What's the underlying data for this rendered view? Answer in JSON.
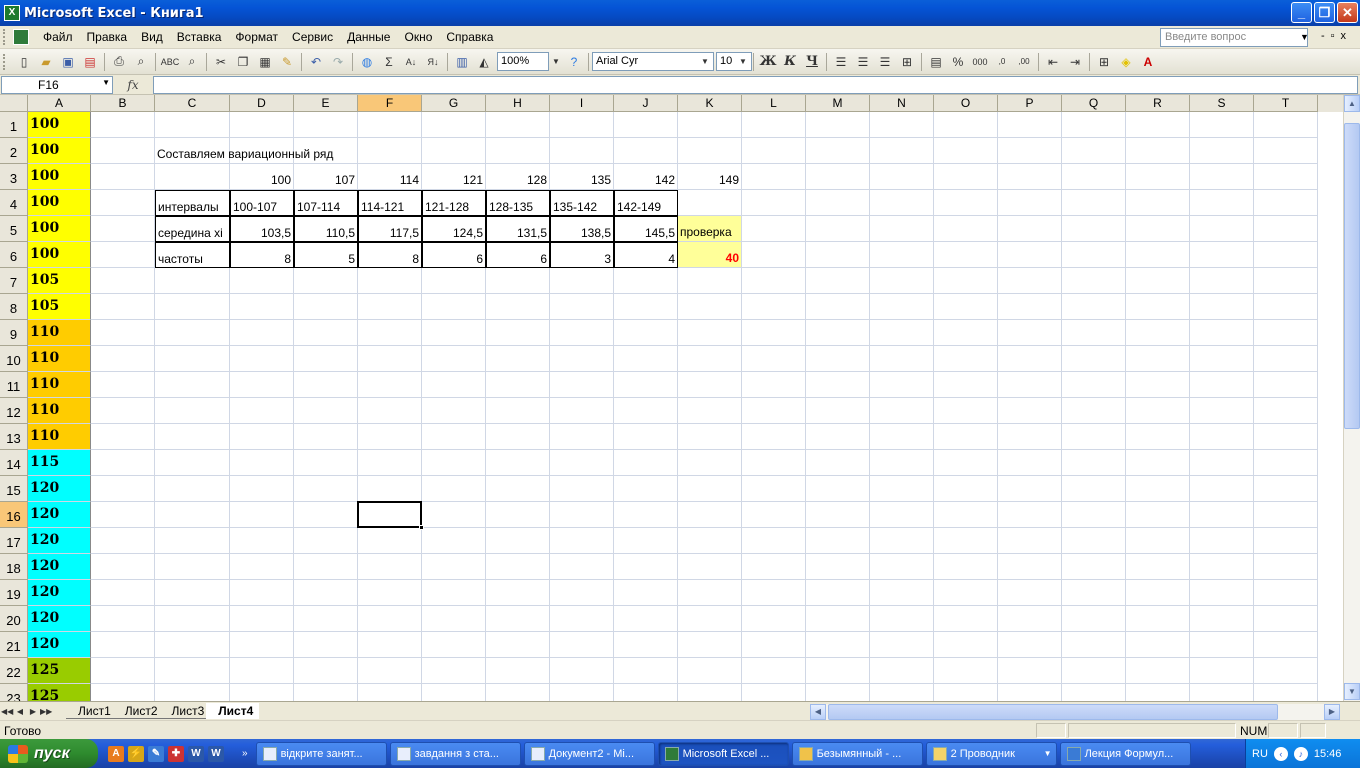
{
  "window": {
    "title": "Microsoft Excel - Книга1",
    "icon": "excel-icon"
  },
  "menu": [
    "Файл",
    "Правка",
    "Вид",
    "Вставка",
    "Формат",
    "Сервис",
    "Данные",
    "Окно",
    "Справка"
  ],
  "ask_placeholder": "Введите вопрос",
  "toolbar": {
    "zoom": "100%",
    "font": "Arial Cyr",
    "font_size": "10",
    "bold": "Ж",
    "italic": "К",
    "underline": "Ч"
  },
  "formula_bar": {
    "name_box": "F16",
    "fx": "fx",
    "formula": ""
  },
  "columns": [
    "A",
    "B",
    "C",
    "D",
    "E",
    "F",
    "G",
    "H",
    "I",
    "J",
    "K",
    "L",
    "M",
    "N",
    "O",
    "P",
    "Q",
    "R",
    "S",
    "T"
  ],
  "selected_column": "F",
  "selected_row": "16",
  "rows": [
    "1",
    "2",
    "3",
    "4",
    "5",
    "6",
    "7",
    "8",
    "9",
    "10",
    "11",
    "12",
    "13",
    "14",
    "15",
    "16",
    "17",
    "18",
    "19",
    "20",
    "21",
    "22",
    "23"
  ],
  "col_a_values": [
    "100",
    "100",
    "100",
    "100",
    "100",
    "100",
    "105",
    "105",
    "110",
    "110",
    "110",
    "110",
    "110",
    "115",
    "120",
    "120",
    "120",
    "120",
    "120",
    "120",
    "120",
    "125",
    "125"
  ],
  "colors": {
    "yellow": "#ffff00",
    "orange": "#ffcc00",
    "cyan": "#00ffff",
    "green": "#99cc00",
    "check_bg": "#ffff99",
    "check_text": "#ff0000",
    "selection": "#f9c778"
  },
  "table": {
    "title": "Составляем вариационный ряд",
    "bounds": [
      "100",
      "107",
      "114",
      "121",
      "128",
      "135",
      "142",
      "149"
    ],
    "intervals_label": "интервалы",
    "intervals": [
      "100-107",
      "107-114",
      "114-121",
      "121-128",
      "128-135",
      "135-142",
      "142-149"
    ],
    "mid_label": "середина xi",
    "mids": [
      "103,5",
      "110,5",
      "117,5",
      "124,5",
      "131,5",
      "138,5",
      "145,5"
    ],
    "freq_label": "частоты",
    "freqs": [
      "8",
      "5",
      "8",
      "6",
      "6",
      "3",
      "4"
    ],
    "check_label": "проверка",
    "check_value": "40"
  },
  "sheets": [
    "Лист1",
    "Лист2",
    "Лист3",
    "Лист4"
  ],
  "active_sheet": "Лист4",
  "status": {
    "ready": "Готово",
    "num": "NUM"
  },
  "taskbar": {
    "start": "пуск",
    "tasks": [
      "відкрите занят...",
      "завдання з ста...",
      "Документ2 - Mi...",
      "Microsoft Excel ...",
      "Безымянный - ...",
      "2 Проводник",
      "Лекция Формул..."
    ],
    "active_task": "Microsoft Excel ...",
    "lang": "RU",
    "time": "15:46"
  }
}
